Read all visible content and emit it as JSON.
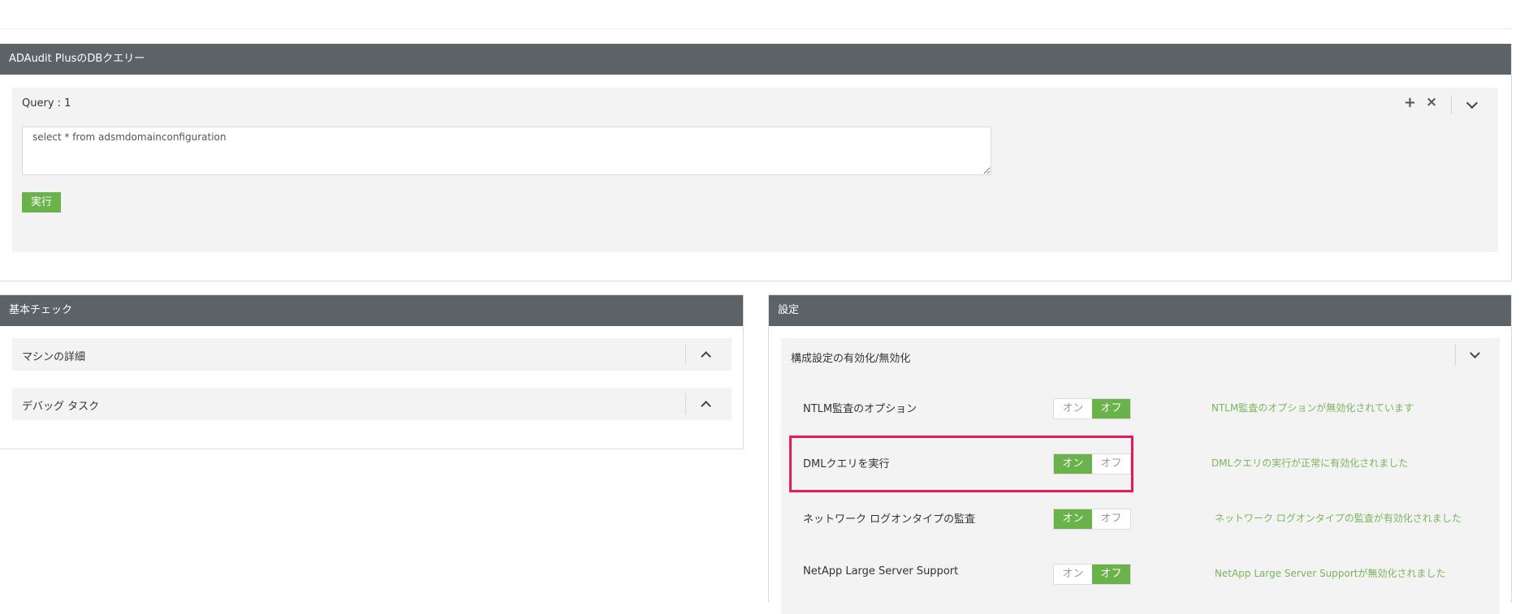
{
  "query_panel": {
    "header": "ADAudit PlusのDBクエリー",
    "query_title": "Query : 1",
    "plus_icon": "+",
    "close_icon": "×",
    "query_text": "select * from adsmdomainconfiguration",
    "run_label": "実行"
  },
  "basic_panel": {
    "header": "基本チェック",
    "items": [
      {
        "label": "マシンの詳細"
      },
      {
        "label": "デバッグ タスク"
      }
    ]
  },
  "settings_panel": {
    "header": "設定",
    "section_title": "構成設定の有効化/無効化",
    "options": [
      {
        "label": "NTLM監査のオプション",
        "on": "オン",
        "off": "オフ",
        "state": "off",
        "status": "NTLM監査のオプションが無効化されています"
      },
      {
        "label": "DMLクエリを実行",
        "on": "オン",
        "off": "オフ",
        "state": "on",
        "status": "DMLクエリの実行が正常に有効化されました"
      },
      {
        "label": "ネットワーク ログオンタイプの監査",
        "on": "オン",
        "off": "オフ",
        "state": "on",
        "status": "ネットワーク ログオンタイプの監査が有効化されました"
      },
      {
        "label": "NetApp Large Server Support",
        "on": "オン",
        "off": "オフ",
        "state": "off",
        "status": "NetApp Large Server Supportが無効化されました"
      }
    ]
  },
  "colors": {
    "header_bg": "#5b6368",
    "accent_green": "#6ab34a",
    "status_green": "#7ab55c",
    "highlight": "#e8195b"
  }
}
